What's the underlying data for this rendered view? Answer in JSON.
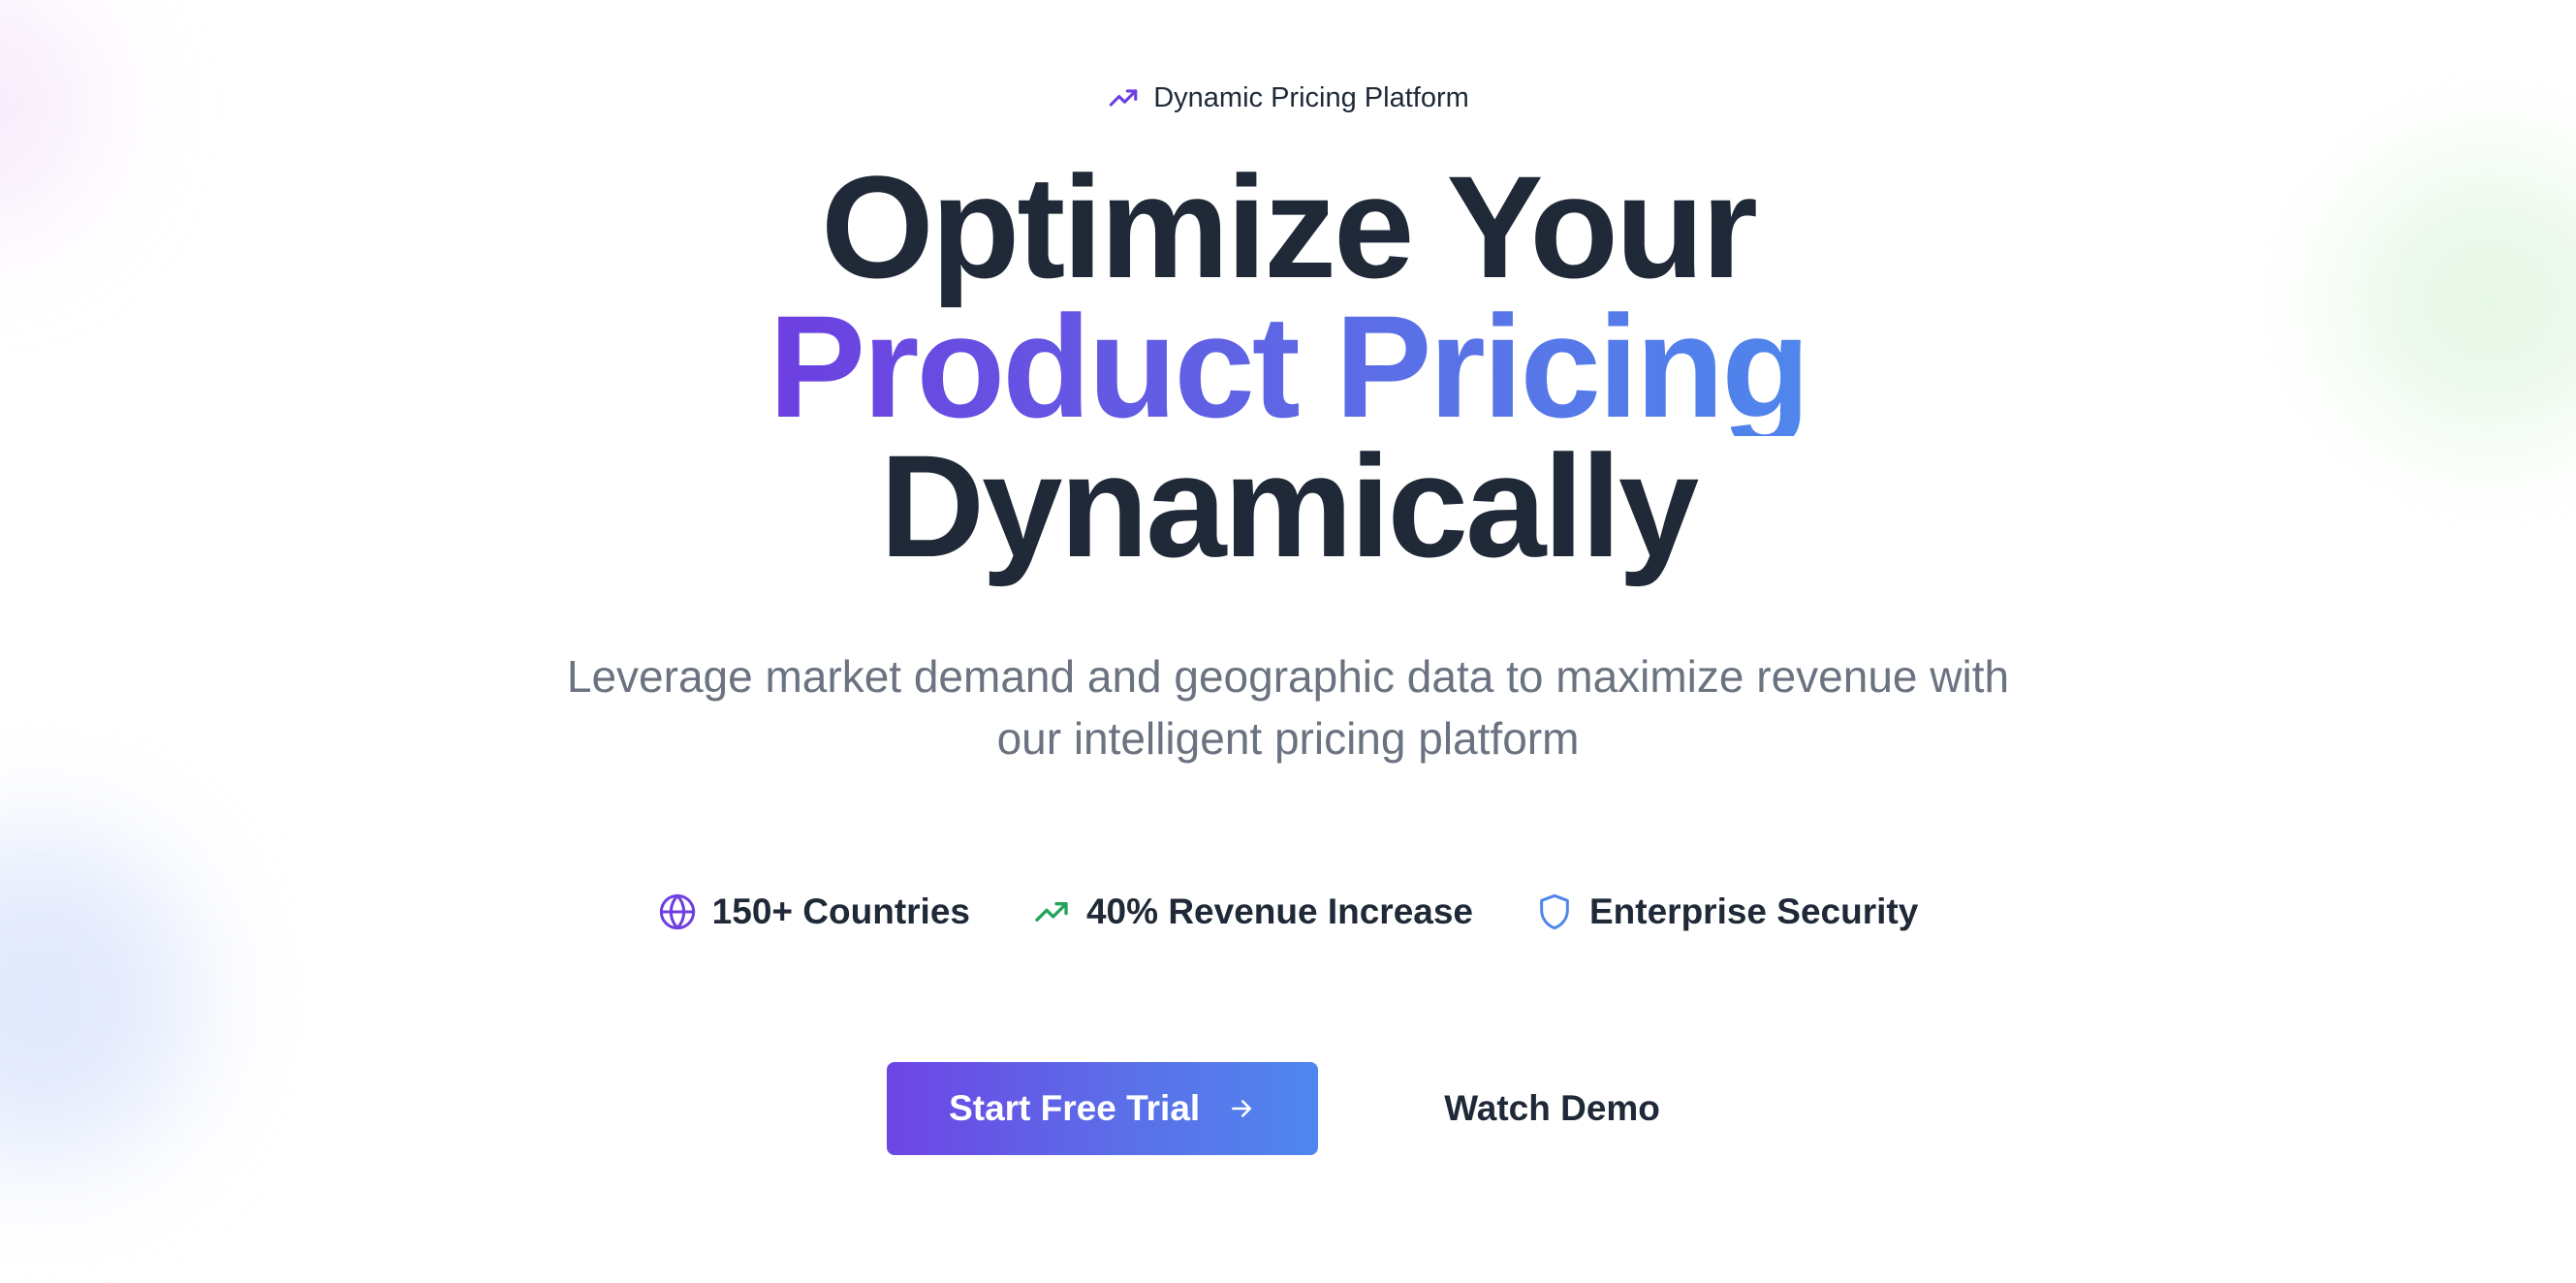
{
  "colors": {
    "text_dark": "#1f2937",
    "text_muted": "#6b7280",
    "brand_purple": "#6d3fe0",
    "brand_blue": "#4f86ec",
    "accent_green": "#22a35a"
  },
  "badge": {
    "icon": "trending-up-icon",
    "label": "Dynamic Pricing Platform"
  },
  "hero": {
    "title_line1": "Optimize Your",
    "title_line2": "Product Pricing",
    "title_line3": "Dynamically",
    "subtitle": "Leverage market demand and geographic data to maximize revenue with our intelligent pricing platform"
  },
  "features": [
    {
      "icon": "globe-icon",
      "label": "150+ Countries"
    },
    {
      "icon": "trending-up-icon",
      "label": "40% Revenue Increase"
    },
    {
      "icon": "shield-icon",
      "label": "Enterprise Security"
    }
  ],
  "actions": {
    "primary_label": "Start Free Trial",
    "primary_icon": "arrow-right-icon",
    "secondary_label": "Watch Demo"
  }
}
